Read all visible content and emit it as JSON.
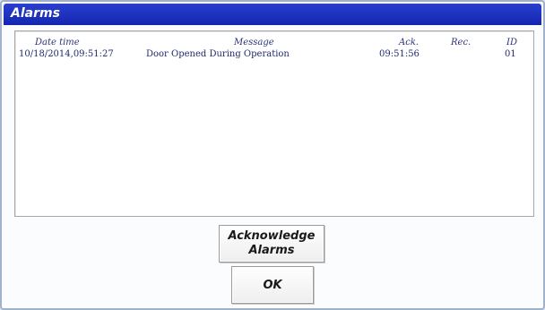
{
  "window": {
    "title": "Alarms"
  },
  "table": {
    "columns": {
      "date_time": "Date time",
      "message": "Message",
      "ack": "Ack.",
      "rec": "Rec.",
      "id": "ID"
    },
    "rows": [
      {
        "date_time": "10/18/2014,09:51:27",
        "message": "Door Opened During Operation",
        "ack": "09:51:56",
        "rec": "",
        "id": "01"
      }
    ]
  },
  "buttons": {
    "acknowledge_line1": "Acknowledge",
    "acknowledge_line2": "Alarms",
    "ok": "OK"
  },
  "colors": {
    "titlebar": "#1426b0",
    "background": "#fbfcfd",
    "row_text": "#1e2a6e"
  }
}
